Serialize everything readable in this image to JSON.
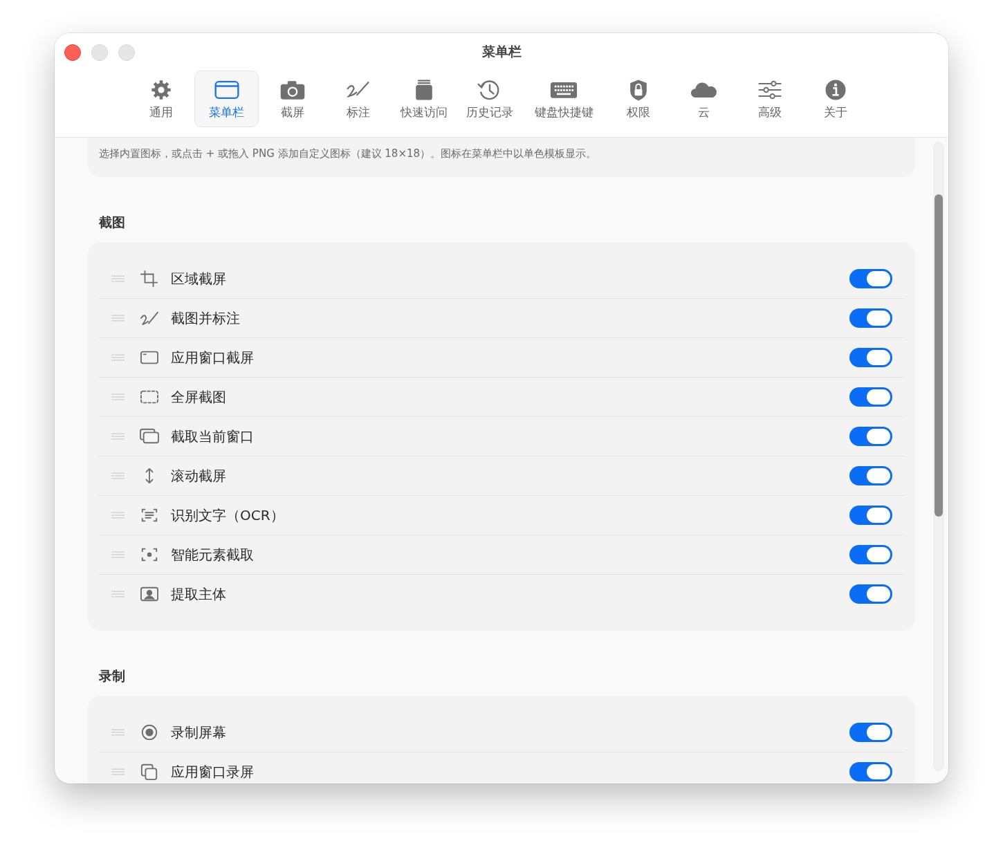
{
  "window": {
    "title": "菜单栏"
  },
  "tabs": [
    {
      "label": "通用",
      "selected": false
    },
    {
      "label": "菜单栏",
      "selected": true
    },
    {
      "label": "截屏",
      "selected": false
    },
    {
      "label": "标注",
      "selected": false
    },
    {
      "label": "快速访问",
      "selected": false
    },
    {
      "label": "历史记录",
      "selected": false
    },
    {
      "label": "键盘快捷键",
      "selected": false
    },
    {
      "label": "权限",
      "selected": false
    },
    {
      "label": "云",
      "selected": false
    },
    {
      "label": "高级",
      "selected": false
    },
    {
      "label": "关于",
      "selected": false
    }
  ],
  "hint": "选择内置图标，或点击 + 或拖入 PNG 添加自定义图标（建议 18×18）。图标在菜单栏中以单色模板显示。",
  "sections": [
    {
      "title": "截图",
      "items": [
        {
          "label": "区域截屏",
          "on": true
        },
        {
          "label": "截图并标注",
          "on": true
        },
        {
          "label": "应用窗口截屏",
          "on": true
        },
        {
          "label": "全屏截图",
          "on": true
        },
        {
          "label": "截取当前窗口",
          "on": true
        },
        {
          "label": "滚动截屏",
          "on": true
        },
        {
          "label": "识别文字（OCR）",
          "on": true
        },
        {
          "label": "智能元素截取",
          "on": true
        },
        {
          "label": "提取主体",
          "on": true
        }
      ]
    },
    {
      "title": "录制",
      "items": [
        {
          "label": "录制屏幕",
          "on": true
        },
        {
          "label": "应用窗口录屏",
          "on": true
        }
      ]
    }
  ]
}
